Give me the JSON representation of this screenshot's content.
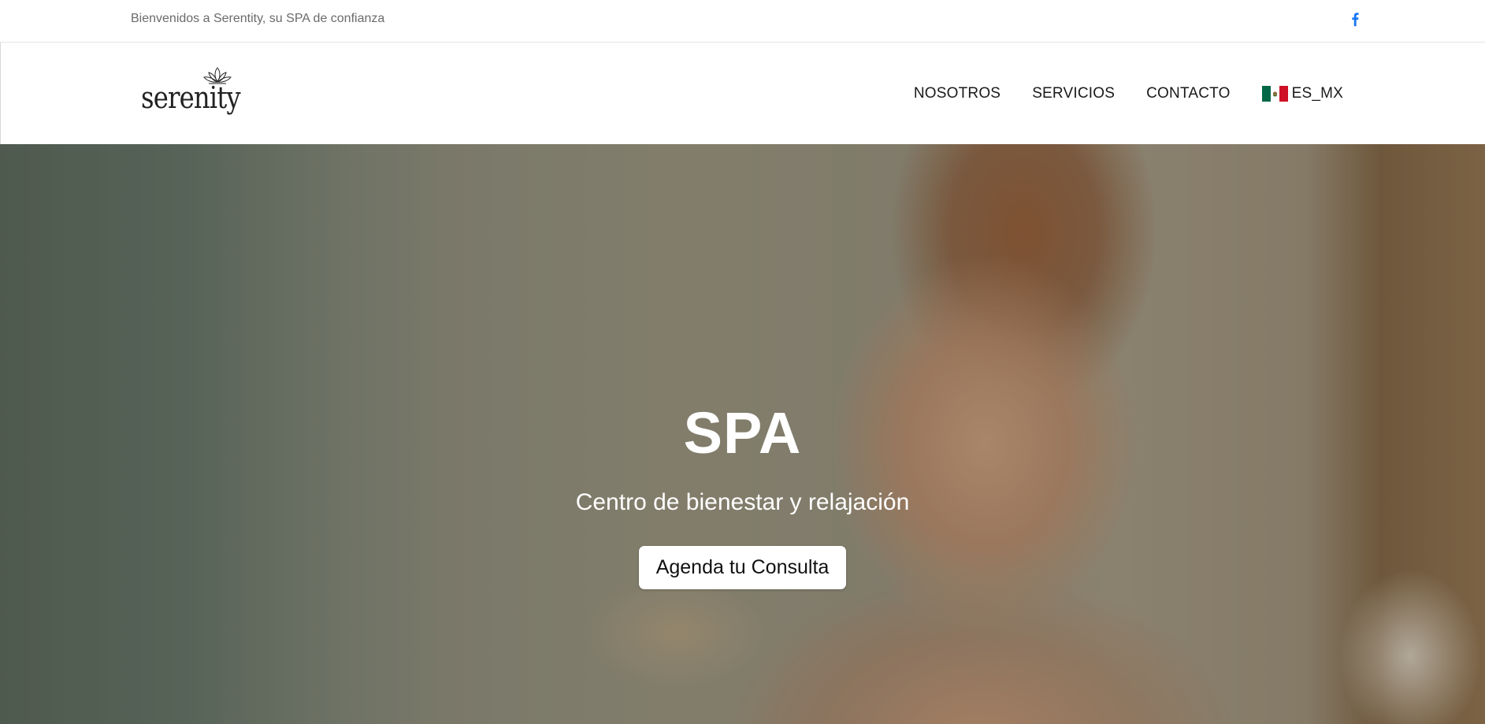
{
  "topbar": {
    "welcome_text": "Bienvenidos a Serentity, su SPA de confianza",
    "social_icon": "facebook-icon",
    "social_color": "#1877f2"
  },
  "header": {
    "logo_text": "serenity",
    "logo_icon": "lotus-icon",
    "nav": {
      "nosotros": "NOSOTROS",
      "servicios": "SERVICIOS",
      "contacto": "CONTACTO"
    },
    "language": {
      "label": "ES_MX",
      "flag_icon": "mexico-flag-icon",
      "flag_colors": [
        "#006847",
        "#ffffff",
        "#ce1126"
      ]
    }
  },
  "hero": {
    "title": "SPA",
    "subtitle": "Centro de bienestar y relajación",
    "cta_label": "Agenda tu Consulta"
  }
}
